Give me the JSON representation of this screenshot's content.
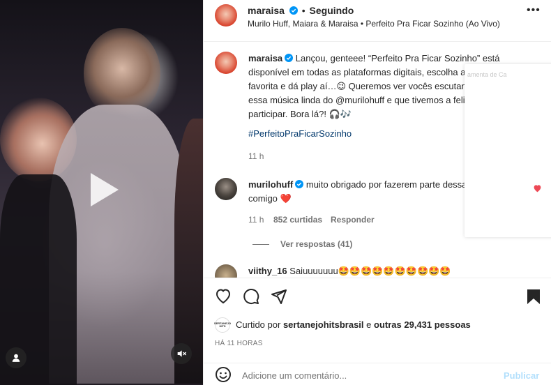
{
  "post": {
    "username": "maraisa",
    "follow_status": "Seguindo",
    "audio": "Murilo Huff, Maiara & Maraisa • Perfeito Pra Ficar Sozinho (Ao Vivo)",
    "more": "•••"
  },
  "caption": {
    "username": "maraisa",
    "line1": "Lançou, genteee! “Perfeito Pra Ficar Sozinho” está",
    "line2": "disponível em todas as plataformas digitais, escolha a sua",
    "line3": "favorita e dá play aí…😉 Queremos ver vocês escutando muito",
    "line4": "essa música linda do @murilohuff e que tivemos a felicidade de",
    "line5": "participar. Bora lá?! 🎧🎶",
    "hashtag": "#PerfeitoPraFicarSozinho",
    "time": "11 h"
  },
  "comment": {
    "username": "murilohuff",
    "line1": "muito obrigado por fazerem parte dessa história",
    "line2": "comigo ❤️",
    "time": "11 h",
    "likes": "852 curtidas",
    "reply": "Responder",
    "view_replies": "Ver respostas (41)"
  },
  "comment2": {
    "username": "viithy_16",
    "text": "Saiuuuuuuu🤩🤩🤩🤩🤩🤩🤩🤩🤩🤩"
  },
  "popup": {
    "text": "amenta de Ca"
  },
  "likes": {
    "prefix": "Curtido por",
    "user": "sertanejohitsbrasil",
    "middle": "e",
    "others": "outras 29,431 pessoas",
    "avatar_text": "SERTANEJO HITS"
  },
  "date": "HÁ 11 HORAS",
  "comment_input": {
    "placeholder": "Adicione um comentário...",
    "publish": "Publicar"
  },
  "colors": {
    "link": "#00376b",
    "publish": "#b2dffc",
    "verified": "#0095f6",
    "heart": "#ed4956"
  }
}
